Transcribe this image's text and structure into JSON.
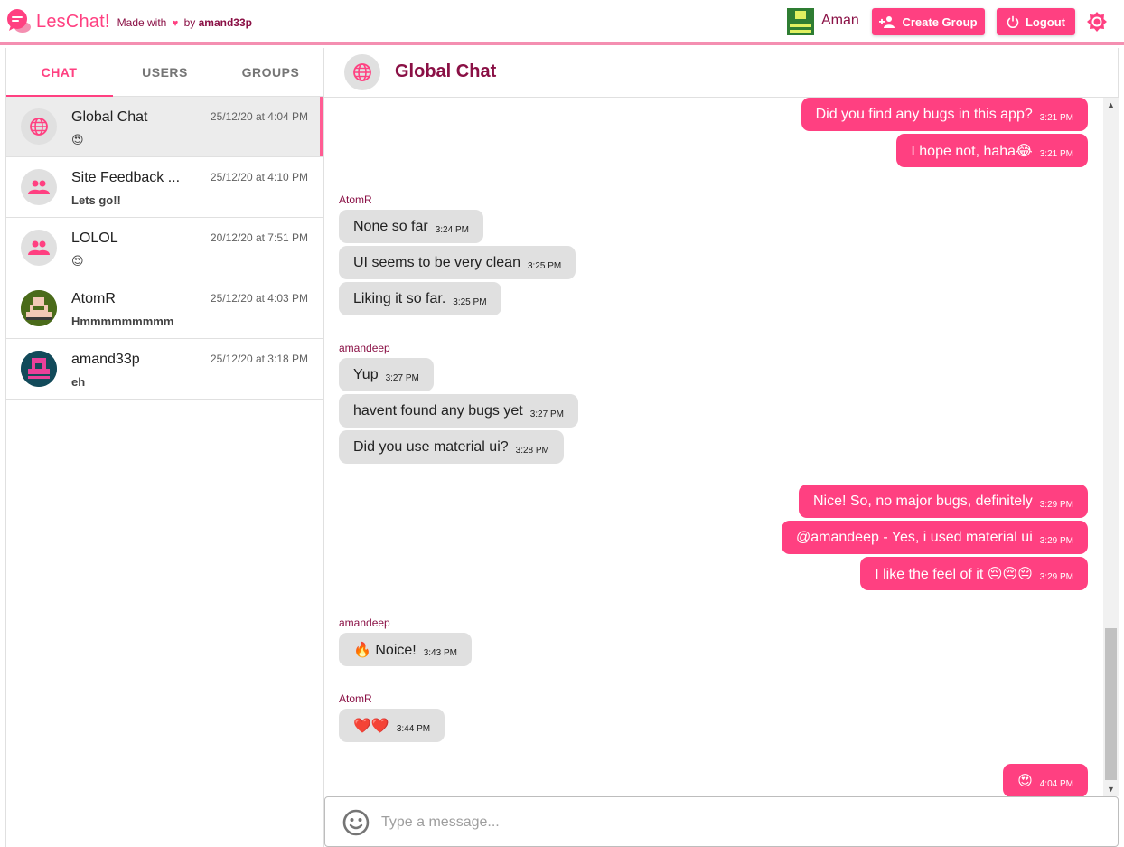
{
  "colors": {
    "accent": "#ff4081",
    "accent_dark": "#8a1045",
    "bubble_in": "#e0e0e0"
  },
  "header": {
    "app_name": "LesChat!",
    "made_with": "Made with",
    "heart": "♥",
    "by": "by",
    "author": "amand33p",
    "user_name": "Aman",
    "create_group_label": "Create Group",
    "logout_label": "Logout"
  },
  "sidebar": {
    "tabs": [
      {
        "label": "CHAT"
      },
      {
        "label": "USERS"
      },
      {
        "label": "GROUPS"
      }
    ],
    "chats": [
      {
        "name": "Global Chat",
        "time": "25/12/20 at 4:04 PM",
        "preview": "😍",
        "icon": "globe-icon"
      },
      {
        "name": "Site Feedback ...",
        "time": "25/12/20 at 4:10 PM",
        "preview": "Lets go!!",
        "icon": "group-icon"
      },
      {
        "name": "LOLOL",
        "time": "20/12/20 at 7:51 PM",
        "preview": "😍",
        "icon": "group-icon"
      },
      {
        "name": "AtomR",
        "time": "25/12/20 at 4:03 PM",
        "preview": "Hmmmmmmmmm",
        "icon": "avatar"
      },
      {
        "name": "amand33p",
        "time": "25/12/20 at 3:18 PM",
        "preview": "eh",
        "icon": "avatar"
      }
    ]
  },
  "main": {
    "title": "Global Chat",
    "messages": [
      {
        "text": "Did you find any bugs in this app?",
        "time": "3:21 PM"
      },
      {
        "text": "I hope not, haha😂",
        "time": "3:21 PM"
      },
      {
        "sender": "AtomR"
      },
      {
        "text": "None so far",
        "time": "3:24 PM"
      },
      {
        "text": "UI seems to be very clean",
        "time": "3:25 PM"
      },
      {
        "text": "Liking it so far.",
        "time": "3:25 PM"
      },
      {
        "sender": "amandeep"
      },
      {
        "text": "Yup",
        "time": "3:27 PM"
      },
      {
        "text": "havent found any bugs yet",
        "time": "3:27 PM"
      },
      {
        "text": "Did you use material ui?",
        "time": "3:28 PM"
      },
      {
        "text": "Nice! So, no major bugs, definitely",
        "time": "3:29 PM"
      },
      {
        "text": "@amandeep - Yes, i used material ui",
        "time": "3:29 PM"
      },
      {
        "text": "I like the feel of it 😔😔😔",
        "time": "3:29 PM"
      },
      {
        "sender": "amandeep"
      },
      {
        "text": "🔥 Noice!",
        "time": "3:43 PM"
      },
      {
        "sender": "AtomR"
      },
      {
        "text": "❤️❤️",
        "time": "3:44 PM"
      },
      {
        "text": "😍",
        "time": "4:04 PM"
      }
    ]
  },
  "composer": {
    "placeholder": "Type a message..."
  }
}
